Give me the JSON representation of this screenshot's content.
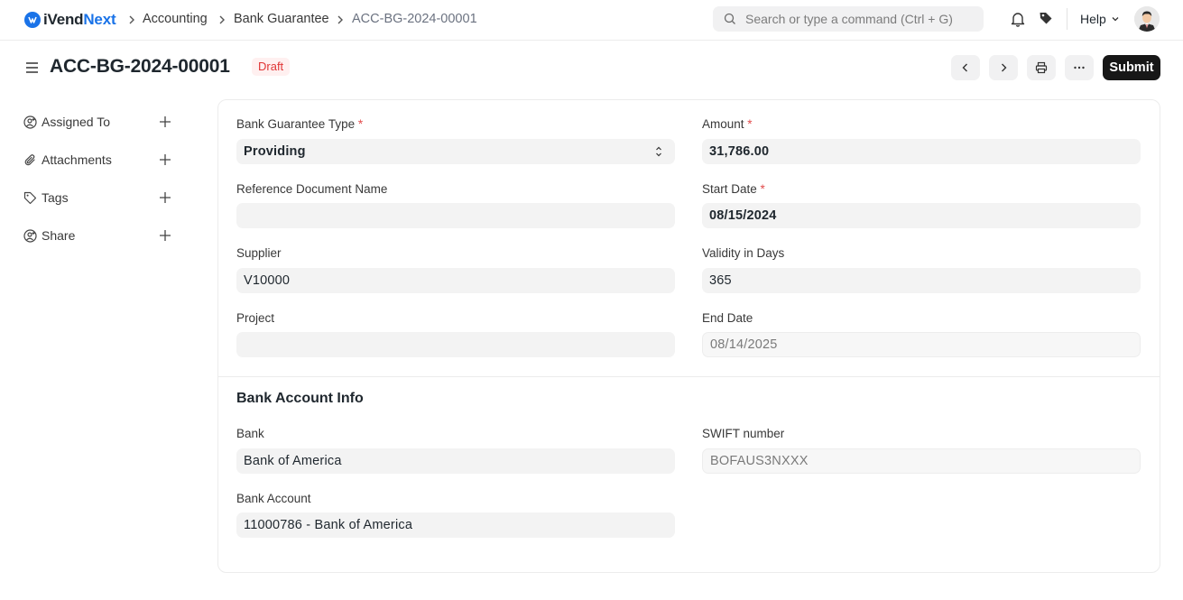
{
  "brand": {
    "name_plain": "iVend",
    "name_accent": "Next",
    "accent_color": "#1a73e8"
  },
  "breadcrumbs": [
    "Accounting",
    "Bank Guarantee",
    "ACC-BG-2024-00001"
  ],
  "search": {
    "placeholder": "Search or type a command (Ctrl + G)"
  },
  "navbar": {
    "help_label": "Help",
    "icons": [
      "bell-icon",
      "tag-icon"
    ]
  },
  "page": {
    "title": "ACC-BG-2024-00001",
    "status": "Draft",
    "submit_label": "Submit"
  },
  "sidebar": {
    "items": [
      {
        "label": "Assigned To",
        "icon": "assign-user-icon"
      },
      {
        "label": "Attachments",
        "icon": "paperclip-icon"
      },
      {
        "label": "Tags",
        "icon": "tag-icon"
      },
      {
        "label": "Share",
        "icon": "share-user-icon"
      }
    ]
  },
  "form": {
    "bank_guarantee_type": {
      "label": "Bank Guarantee Type",
      "value": "Providing"
    },
    "amount": {
      "label": "Amount",
      "value": "31,786.00"
    },
    "reference_document_name": {
      "label": "Reference Document Name",
      "value": ""
    },
    "start_date": {
      "label": "Start Date",
      "value": "08/15/2024"
    },
    "supplier": {
      "label": "Supplier",
      "value": "V10000"
    },
    "validity_in_days": {
      "label": "Validity in Days",
      "value": "365"
    },
    "project": {
      "label": "Project",
      "value": ""
    },
    "end_date": {
      "label": "End Date",
      "value": "08/14/2025"
    },
    "bank_account_section": {
      "title": "Bank Account Info"
    },
    "bank": {
      "label": "Bank",
      "value": "Bank of America"
    },
    "swift_number": {
      "label": "SWIFT number",
      "value": "BOFAUS3NXXX"
    },
    "bank_account": {
      "label": "Bank Account",
      "value": "11000786 - Bank of America"
    }
  }
}
